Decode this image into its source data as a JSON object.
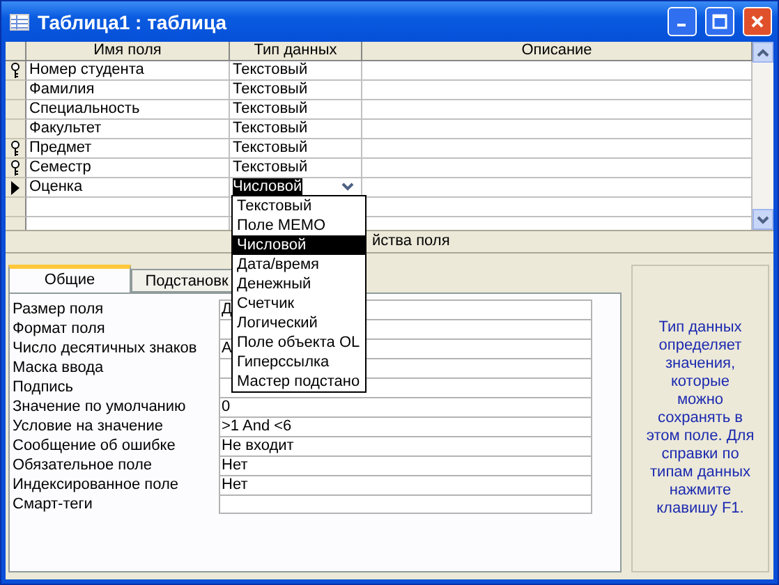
{
  "window": {
    "title": "Таблица1 : таблица"
  },
  "grid": {
    "columns": [
      "Имя поля",
      "Тип данных",
      "Описание"
    ],
    "rows": [
      {
        "name": "Номер студента",
        "type": "Текстовый",
        "key": true,
        "current": false
      },
      {
        "name": "Фамилия",
        "type": "Текстовый",
        "key": false,
        "current": false
      },
      {
        "name": "Специальность",
        "type": "Текстовый",
        "key": false,
        "current": false
      },
      {
        "name": "Факультет",
        "type": "Текстовый",
        "key": false,
        "current": false
      },
      {
        "name": "Предмет",
        "type": "Текстовый",
        "key": true,
        "current": false
      },
      {
        "name": "Семестр",
        "type": "Текстовый",
        "key": true,
        "current": false
      },
      {
        "name": "Оценка",
        "type": "Числовой",
        "key": false,
        "current": true
      }
    ]
  },
  "type_dropdown": {
    "options": [
      {
        "label": "Текстовый",
        "selected": false
      },
      {
        "label": "Поле MEMO",
        "selected": false
      },
      {
        "label": "Числовой",
        "selected": true
      },
      {
        "label": "Дата/время",
        "selected": false
      },
      {
        "label": "Денежный",
        "selected": false
      },
      {
        "label": "Счетчик",
        "selected": false
      },
      {
        "label": "Логический",
        "selected": false
      },
      {
        "label": "Поле объекта OL",
        "selected": false
      },
      {
        "label": "Гиперссылка",
        "selected": false
      },
      {
        "label": "Мастер подстано",
        "selected": false
      }
    ]
  },
  "field_properties": {
    "label": "йства поля",
    "tabs": [
      {
        "label": "Общие",
        "selected": true
      },
      {
        "label": "Подстановк",
        "selected": false
      }
    ],
    "rows": [
      {
        "label": "Размер поля",
        "value": "Д"
      },
      {
        "label": "Формат поля",
        "value": ""
      },
      {
        "label": "Число десятичных знаков",
        "value": "А"
      },
      {
        "label": "Маска ввода",
        "value": ""
      },
      {
        "label": "Подпись",
        "value": ""
      },
      {
        "label": "Значение по умолчанию",
        "value": "0"
      },
      {
        "label": "Условие на значение",
        "value": ">1 And <6"
      },
      {
        "label": "Сообщение об ошибке",
        "value": "Не входит"
      },
      {
        "label": "Обязательное поле",
        "value": "Нет"
      },
      {
        "label": "Индексированное поле",
        "value": "Нет"
      },
      {
        "label": "Смарт-теги",
        "value": ""
      }
    ]
  },
  "help_text": "Тип данных определяет значения, которые можно сохранять в этом поле. Для справки по типам данных нажмите клавишу F1."
}
